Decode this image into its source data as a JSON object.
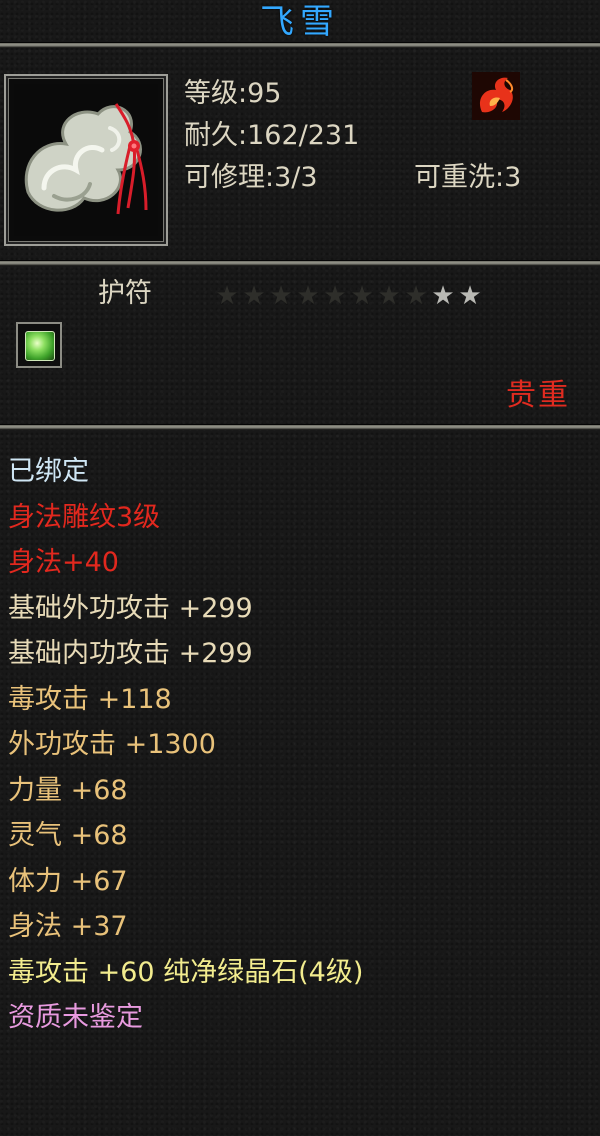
{
  "item": {
    "name": "飞雪",
    "icon": "jade-amulet-icon",
    "level": "等级:95",
    "durability": "耐久:162/231",
    "repairable": "可修理:3/3",
    "rewashable": "可重洗:3",
    "type": "护符",
    "rarity": "贵重",
    "stars": {
      "total": 10,
      "lit": 2
    },
    "gem_icon": "green-gem-icon",
    "element_icon": "flame-icon"
  },
  "attributes": [
    {
      "text": "已绑定",
      "color": "#cfe6f4"
    },
    {
      "text": "身法雕纹3级",
      "color": "#e2281e"
    },
    {
      "text": "身法+40",
      "color": "#e2281e"
    },
    {
      "text": "基础外功攻击 +299",
      "color": "#e8dbb8"
    },
    {
      "text": "基础内功攻击 +299",
      "color": "#e8dbb8"
    },
    {
      "text": "毒攻击 +118",
      "color": "#e9c27a"
    },
    {
      "text": "外功攻击 +1300",
      "color": "#e9c27a"
    },
    {
      "text": "力量 +68",
      "color": "#e9c27a"
    },
    {
      "text": "灵气 +68",
      "color": "#e9c27a"
    },
    {
      "text": "体力 +67",
      "color": "#e9c27a"
    },
    {
      "text": "身法 +37",
      "color": "#e9c27a"
    },
    {
      "text": "毒攻击 +60 纯净绿晶石(4级)",
      "color": "#f2ec8e"
    },
    {
      "text": "资质未鉴定",
      "color": "#e89adf"
    }
  ]
}
